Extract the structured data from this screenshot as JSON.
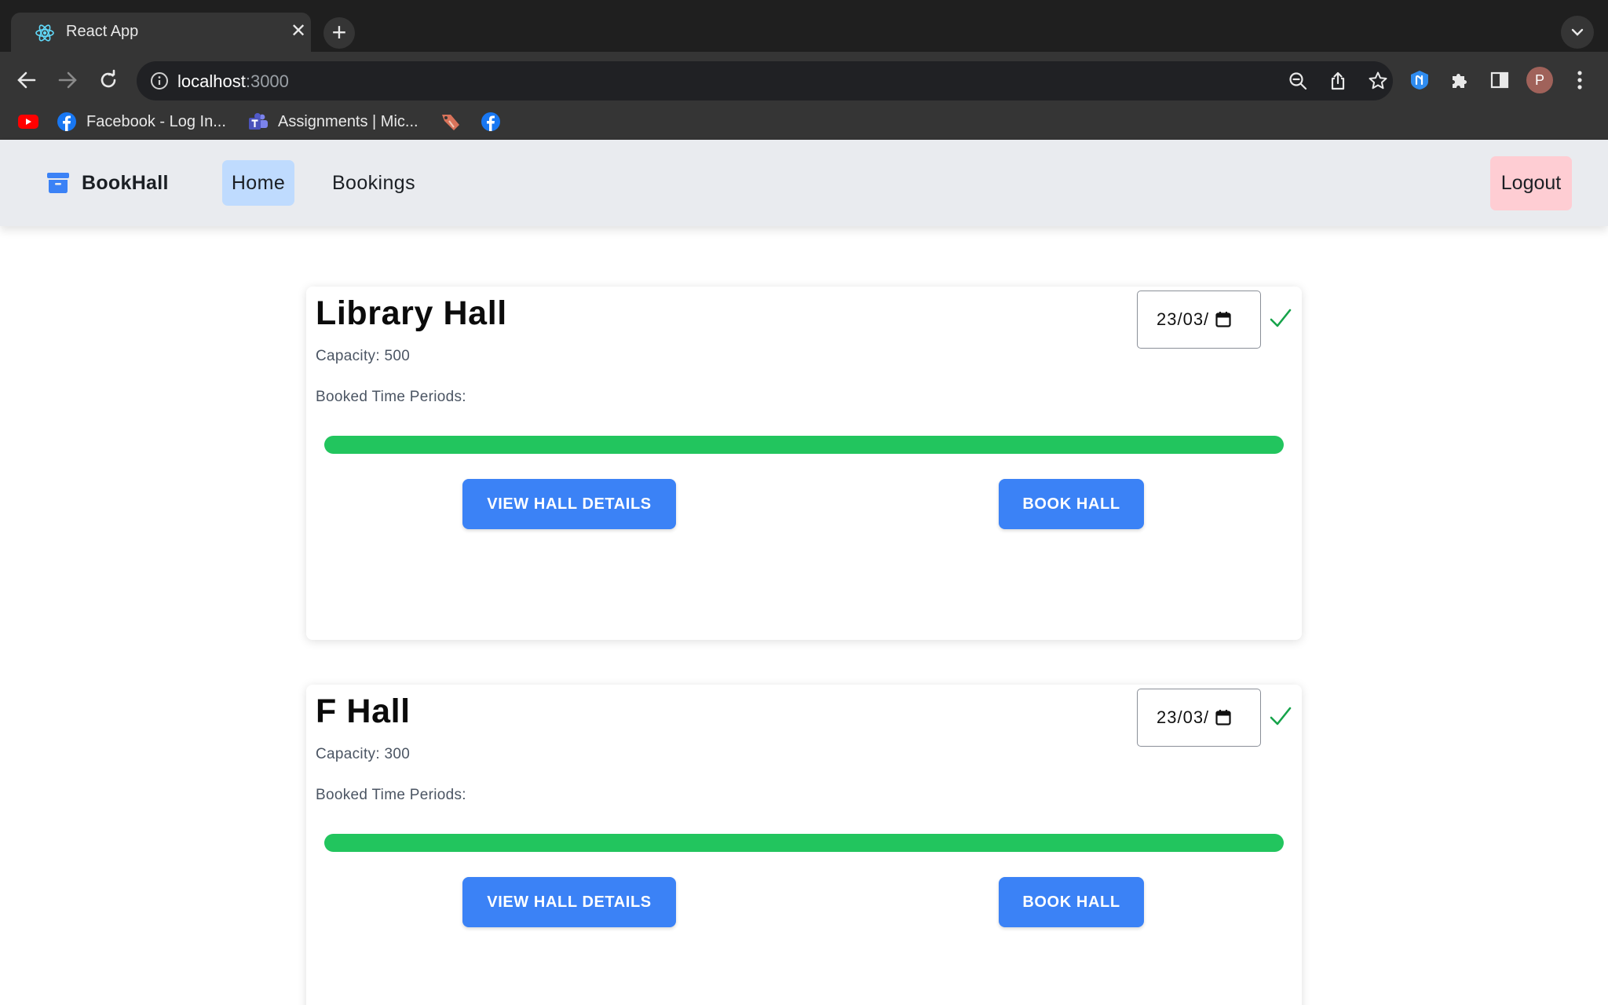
{
  "browser": {
    "tab_title": "React App",
    "url_host": "localhost",
    "url_port": ":3000",
    "profile_initial": "P",
    "bookmarks": [
      {
        "label": "",
        "icon": "youtube-icon"
      },
      {
        "label": "Facebook - Log In...",
        "icon": "facebook-icon"
      },
      {
        "label": "Assignments | Mic...",
        "icon": "teams-icon"
      },
      {
        "label": "",
        "icon": "bookmark-tag-icon"
      },
      {
        "label": "",
        "icon": "facebook-icon"
      }
    ]
  },
  "app": {
    "brand": "BookHall",
    "nav": {
      "home": "Home",
      "bookings": "Bookings",
      "logout": "Logout"
    },
    "halls": [
      {
        "name": "Library Hall",
        "capacity": "Capacity: 500",
        "booked_label": "Booked Time Periods:",
        "date": "23/03/",
        "availability_fraction": 1.0,
        "view_button": "VIEW HALL DETAILS",
        "book_button": "BOOK HALL"
      },
      {
        "name": "F Hall",
        "capacity": "Capacity: 300",
        "booked_label": "Booked Time Periods:",
        "date": "23/03/",
        "availability_fraction": 1.0,
        "view_button": "VIEW HALL DETAILS",
        "book_button": "BOOK HALL"
      }
    ]
  },
  "colors": {
    "accent_blue": "#3b82f6",
    "available_green": "#22c55e",
    "nav_active": "#bfdbfe",
    "logout_bg": "#fecdd3"
  }
}
